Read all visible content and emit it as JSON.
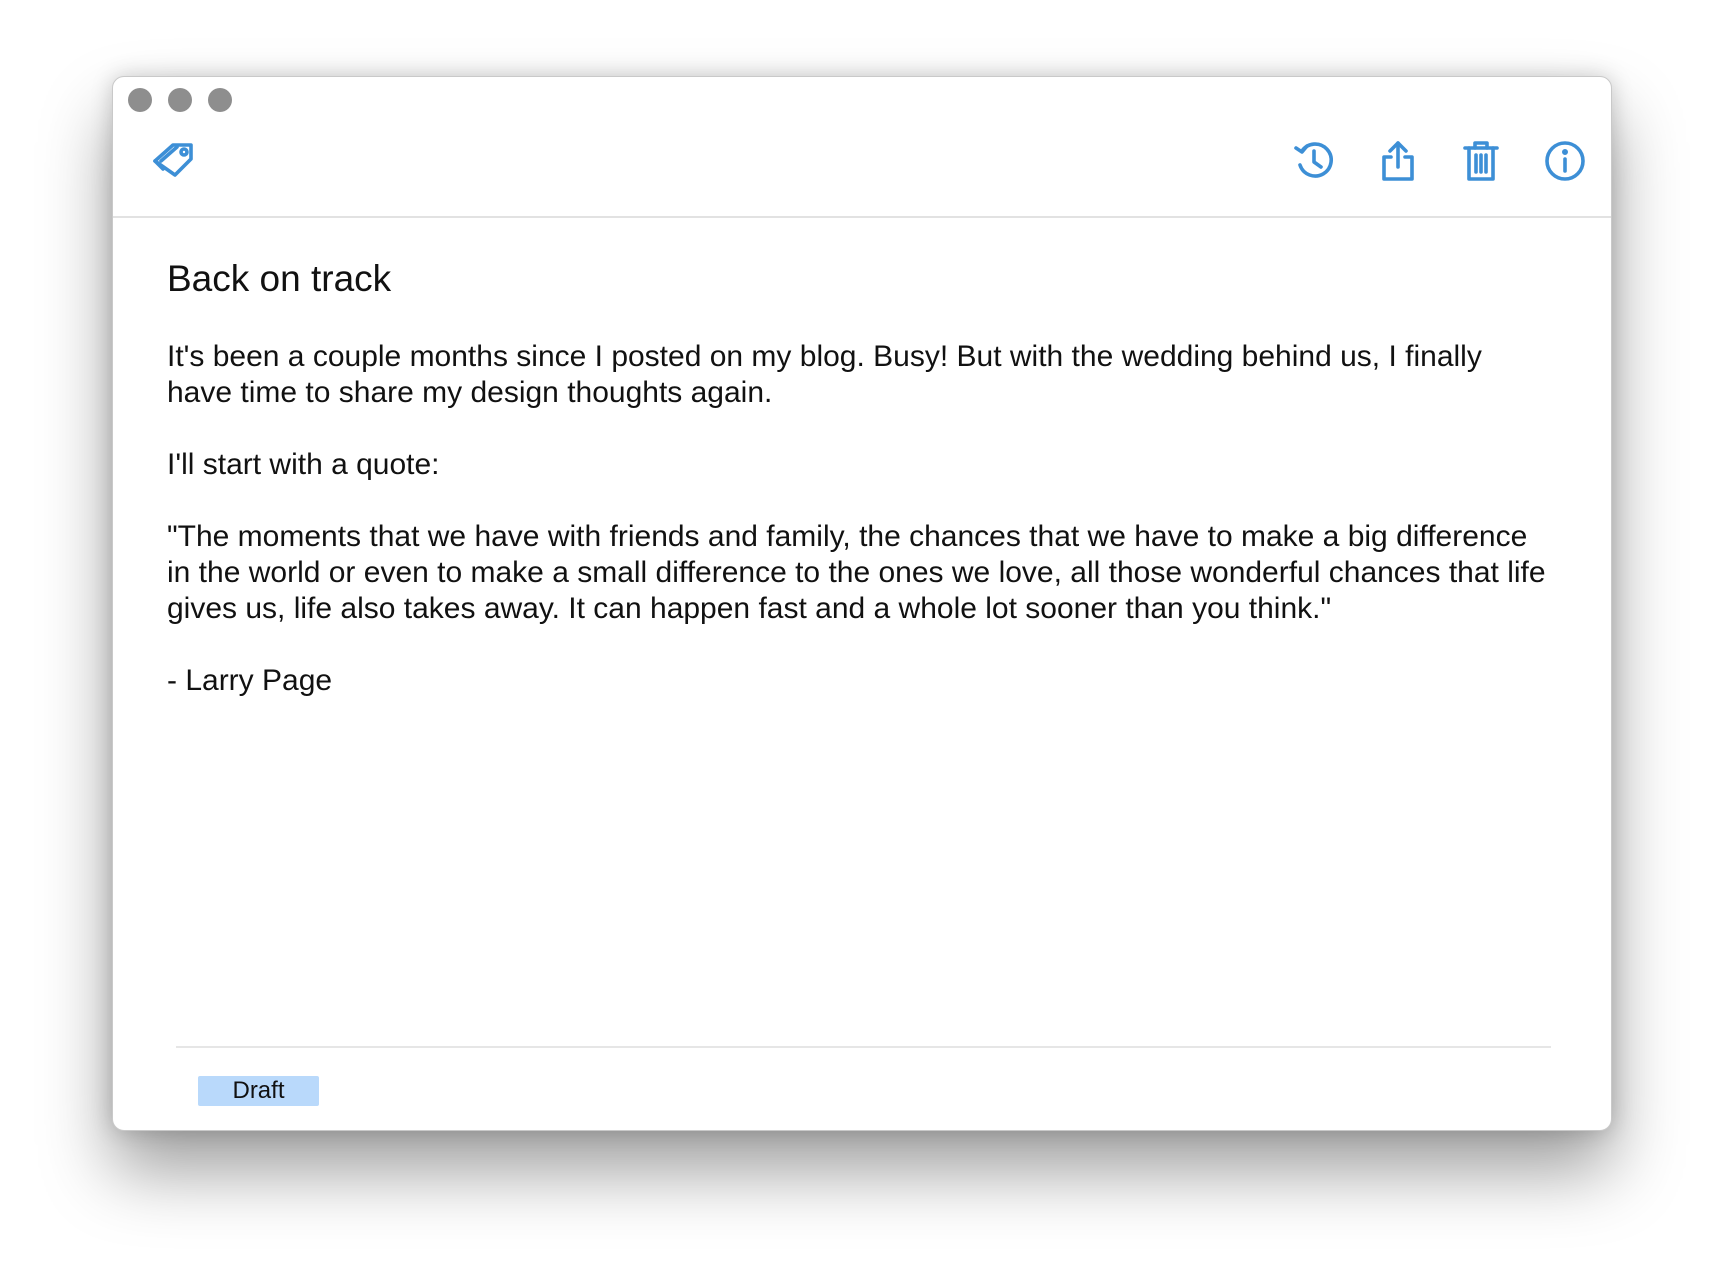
{
  "window": {
    "accent_color": "#3d8fd6"
  },
  "toolbar": {
    "tags_icon": "tag-icon",
    "history_icon": "history-clock-icon",
    "share_icon": "share-icon",
    "trash_icon": "trash-icon",
    "info_icon": "info-icon"
  },
  "note": {
    "title": "Back on track",
    "paragraphs": [
      "It's been a couple months since I posted on my blog. Busy! But with the wedding behind us, I finally have time to share my design thoughts again.",
      "I'll start with a quote:",
      "\"The moments that we have with friends and family, the chances that we have to make a big difference in the world or even to make a small difference to the ones we love, all those wonderful chances that life gives us, life also takes away. It can happen fast and a whole lot sooner than you think.\"",
      "- Larry Page"
    ]
  },
  "tags": [
    {
      "label": "Draft",
      "color": "#b9d9fb"
    }
  ]
}
